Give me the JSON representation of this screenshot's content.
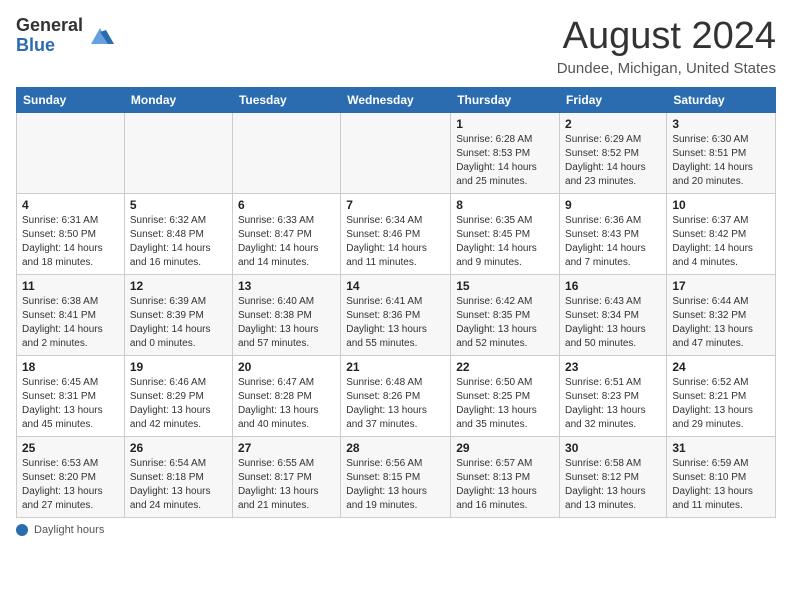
{
  "logo": {
    "line1": "General",
    "line2": "Blue"
  },
  "title": "August 2024",
  "subtitle": "Dundee, Michigan, United States",
  "days_of_week": [
    "Sunday",
    "Monday",
    "Tuesday",
    "Wednesday",
    "Thursday",
    "Friday",
    "Saturday"
  ],
  "footer_label": "Daylight hours",
  "weeks": [
    [
      {
        "day": "",
        "info": ""
      },
      {
        "day": "",
        "info": ""
      },
      {
        "day": "",
        "info": ""
      },
      {
        "day": "",
        "info": ""
      },
      {
        "day": "1",
        "info": "Sunrise: 6:28 AM\nSunset: 8:53 PM\nDaylight: 14 hours and 25 minutes."
      },
      {
        "day": "2",
        "info": "Sunrise: 6:29 AM\nSunset: 8:52 PM\nDaylight: 14 hours and 23 minutes."
      },
      {
        "day": "3",
        "info": "Sunrise: 6:30 AM\nSunset: 8:51 PM\nDaylight: 14 hours and 20 minutes."
      }
    ],
    [
      {
        "day": "4",
        "info": "Sunrise: 6:31 AM\nSunset: 8:50 PM\nDaylight: 14 hours and 18 minutes."
      },
      {
        "day": "5",
        "info": "Sunrise: 6:32 AM\nSunset: 8:48 PM\nDaylight: 14 hours and 16 minutes."
      },
      {
        "day": "6",
        "info": "Sunrise: 6:33 AM\nSunset: 8:47 PM\nDaylight: 14 hours and 14 minutes."
      },
      {
        "day": "7",
        "info": "Sunrise: 6:34 AM\nSunset: 8:46 PM\nDaylight: 14 hours and 11 minutes."
      },
      {
        "day": "8",
        "info": "Sunrise: 6:35 AM\nSunset: 8:45 PM\nDaylight: 14 hours and 9 minutes."
      },
      {
        "day": "9",
        "info": "Sunrise: 6:36 AM\nSunset: 8:43 PM\nDaylight: 14 hours and 7 minutes."
      },
      {
        "day": "10",
        "info": "Sunrise: 6:37 AM\nSunset: 8:42 PM\nDaylight: 14 hours and 4 minutes."
      }
    ],
    [
      {
        "day": "11",
        "info": "Sunrise: 6:38 AM\nSunset: 8:41 PM\nDaylight: 14 hours and 2 minutes."
      },
      {
        "day": "12",
        "info": "Sunrise: 6:39 AM\nSunset: 8:39 PM\nDaylight: 14 hours and 0 minutes."
      },
      {
        "day": "13",
        "info": "Sunrise: 6:40 AM\nSunset: 8:38 PM\nDaylight: 13 hours and 57 minutes."
      },
      {
        "day": "14",
        "info": "Sunrise: 6:41 AM\nSunset: 8:36 PM\nDaylight: 13 hours and 55 minutes."
      },
      {
        "day": "15",
        "info": "Sunrise: 6:42 AM\nSunset: 8:35 PM\nDaylight: 13 hours and 52 minutes."
      },
      {
        "day": "16",
        "info": "Sunrise: 6:43 AM\nSunset: 8:34 PM\nDaylight: 13 hours and 50 minutes."
      },
      {
        "day": "17",
        "info": "Sunrise: 6:44 AM\nSunset: 8:32 PM\nDaylight: 13 hours and 47 minutes."
      }
    ],
    [
      {
        "day": "18",
        "info": "Sunrise: 6:45 AM\nSunset: 8:31 PM\nDaylight: 13 hours and 45 minutes."
      },
      {
        "day": "19",
        "info": "Sunrise: 6:46 AM\nSunset: 8:29 PM\nDaylight: 13 hours and 42 minutes."
      },
      {
        "day": "20",
        "info": "Sunrise: 6:47 AM\nSunset: 8:28 PM\nDaylight: 13 hours and 40 minutes."
      },
      {
        "day": "21",
        "info": "Sunrise: 6:48 AM\nSunset: 8:26 PM\nDaylight: 13 hours and 37 minutes."
      },
      {
        "day": "22",
        "info": "Sunrise: 6:50 AM\nSunset: 8:25 PM\nDaylight: 13 hours and 35 minutes."
      },
      {
        "day": "23",
        "info": "Sunrise: 6:51 AM\nSunset: 8:23 PM\nDaylight: 13 hours and 32 minutes."
      },
      {
        "day": "24",
        "info": "Sunrise: 6:52 AM\nSunset: 8:21 PM\nDaylight: 13 hours and 29 minutes."
      }
    ],
    [
      {
        "day": "25",
        "info": "Sunrise: 6:53 AM\nSunset: 8:20 PM\nDaylight: 13 hours and 27 minutes."
      },
      {
        "day": "26",
        "info": "Sunrise: 6:54 AM\nSunset: 8:18 PM\nDaylight: 13 hours and 24 minutes."
      },
      {
        "day": "27",
        "info": "Sunrise: 6:55 AM\nSunset: 8:17 PM\nDaylight: 13 hours and 21 minutes."
      },
      {
        "day": "28",
        "info": "Sunrise: 6:56 AM\nSunset: 8:15 PM\nDaylight: 13 hours and 19 minutes."
      },
      {
        "day": "29",
        "info": "Sunrise: 6:57 AM\nSunset: 8:13 PM\nDaylight: 13 hours and 16 minutes."
      },
      {
        "day": "30",
        "info": "Sunrise: 6:58 AM\nSunset: 8:12 PM\nDaylight: 13 hours and 13 minutes."
      },
      {
        "day": "31",
        "info": "Sunrise: 6:59 AM\nSunset: 8:10 PM\nDaylight: 13 hours and 11 minutes."
      }
    ]
  ]
}
